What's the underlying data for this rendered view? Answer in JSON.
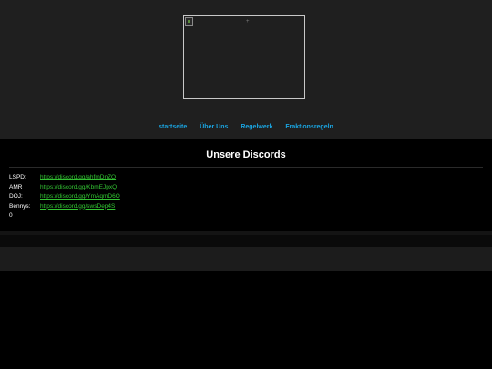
{
  "header": {
    "logo_alt": "+"
  },
  "nav": {
    "items": [
      {
        "label": "startseite"
      },
      {
        "label": "Über Uns"
      },
      {
        "label": "Regelwerk"
      },
      {
        "label": "Fraktionsregeln"
      }
    ]
  },
  "main": {
    "title": "Unsere Discords",
    "discords": [
      {
        "label": "LSPD;",
        "link": "https://discord.gg/ahfmDnZQ"
      },
      {
        "label": "AMR",
        "link": "https://discord.gg/KbmEJpxQ"
      },
      {
        "label": "DOJ:",
        "link": "https://discord.gg/YmAqmD6Q"
      },
      {
        "label": "Bennys:",
        "link": "https://discord.gg/swsDep4S"
      }
    ],
    "trailing": "0"
  },
  "colors": {
    "nav_link": "#1aa4e0",
    "discord_link": "#33c533",
    "header_bg": "#1f1f1f",
    "page_bg": "#000000"
  }
}
